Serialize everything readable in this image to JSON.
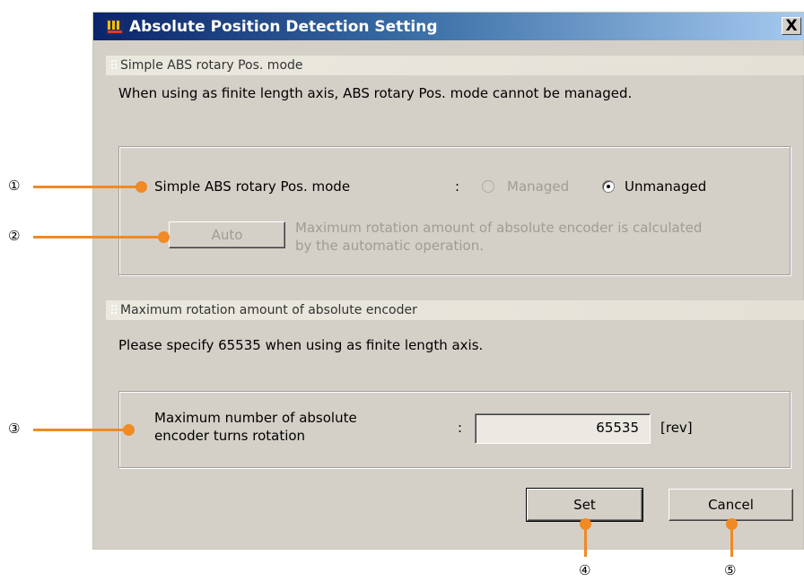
{
  "window": {
    "title": "Absolute Position Detection Setting",
    "close_label": "X"
  },
  "section1": {
    "header": "Simple ABS rotary Pos. mode",
    "note": "When using as finite length axis, ABS rotary Pos. mode cannot be managed.",
    "mode_label": "Simple ABS rotary Pos. mode",
    "colon": ":",
    "option_managed": "Managed",
    "option_unmanaged": "Unmanaged",
    "selected": "Unmanaged",
    "auto_button": "Auto",
    "auto_desc_line1": "Maximum rotation amount of absolute encoder is calculated",
    "auto_desc_line2": "by the automatic operation."
  },
  "section2": {
    "header": "Maximum rotation amount of absolute encoder",
    "note": "Please specify 65535 when using as finite length axis.",
    "field_label_line1": "Maximum number of absolute",
    "field_label_line2": "encoder turns rotation",
    "colon": ":",
    "field_value": "65535",
    "unit": "[rev]"
  },
  "buttons": {
    "set": "Set",
    "cancel": "Cancel"
  },
  "callouts": [
    "①",
    "②",
    "③",
    "④",
    "⑤"
  ],
  "colors": {
    "callout": "#f08a24",
    "titlebar_start": "#0a246a",
    "titlebar_end": "#a6caf0",
    "dialog_bg": "#d4d0c8"
  }
}
